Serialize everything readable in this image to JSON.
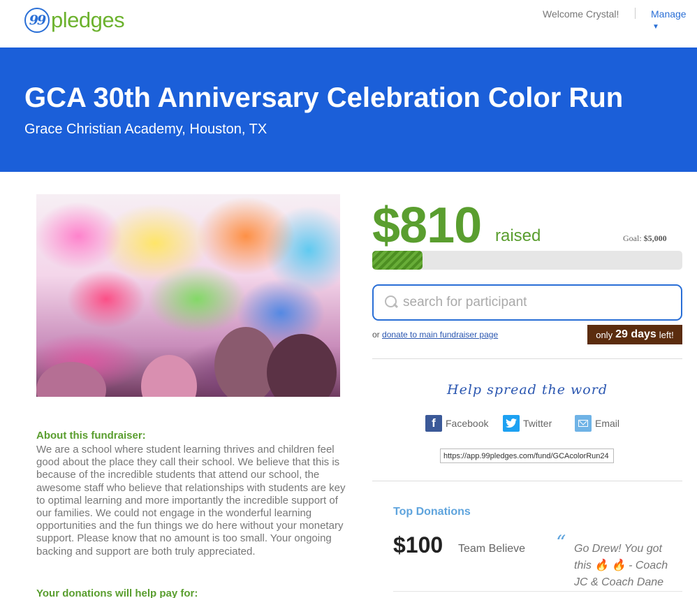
{
  "header": {
    "logo_mark": "99",
    "logo_text": "pledges",
    "welcome": "Welcome Crystal!",
    "manage_label": "Manage",
    "manage_caret": "▼"
  },
  "banner": {
    "title": "GCA 30th Anniversary Celebration Color Run",
    "subtitle": "Grace Christian Academy, Houston, TX",
    "color": "#1b5fd9"
  },
  "stats": {
    "raised_amount": "$810",
    "raised_label": "raised",
    "goal_label": "Goal:",
    "goal_amount": "$5,000",
    "progress_fraction": 0.162
  },
  "search": {
    "placeholder": "search for participant"
  },
  "donate_line": {
    "prefix": "or",
    "link": "donate to main fundraiser page"
  },
  "countdown": {
    "prefix": "only",
    "days": "29 days",
    "suffix": "left!"
  },
  "share": {
    "heading": "Help spread the word",
    "facebook": "Facebook",
    "twitter": "Twitter",
    "email": "Email",
    "url": "https://app.99pledges.com/fund/GCAcolorRun24"
  },
  "top_donations": {
    "title": "Top Donations",
    "items": [
      {
        "amount": "$100",
        "name": "Team Believe",
        "message": "Go Drew! You got this 🔥 🔥 - Coach JC & Coach Dane"
      }
    ]
  },
  "about": {
    "title": "About this fundraiser:",
    "text": "We are a school where student learning thrives and children feel good about the place they call their school. We believe that this is because of the incredible students that attend our school, the awesome staff who believe that relationships with students are key to optimal learning and more importantly the incredible support of our families. We could not engage in the wonderful learning opportunities and the fun things we do here without your monetary support. Please know that no amount is too small. Your ongoing backing and support are both truly appreciated.",
    "pay_title": "Your donations will help pay for:"
  },
  "colors": {
    "green": "#5a9e2f",
    "blue": "#2a6fd6",
    "brown": "#5b2c0e"
  }
}
